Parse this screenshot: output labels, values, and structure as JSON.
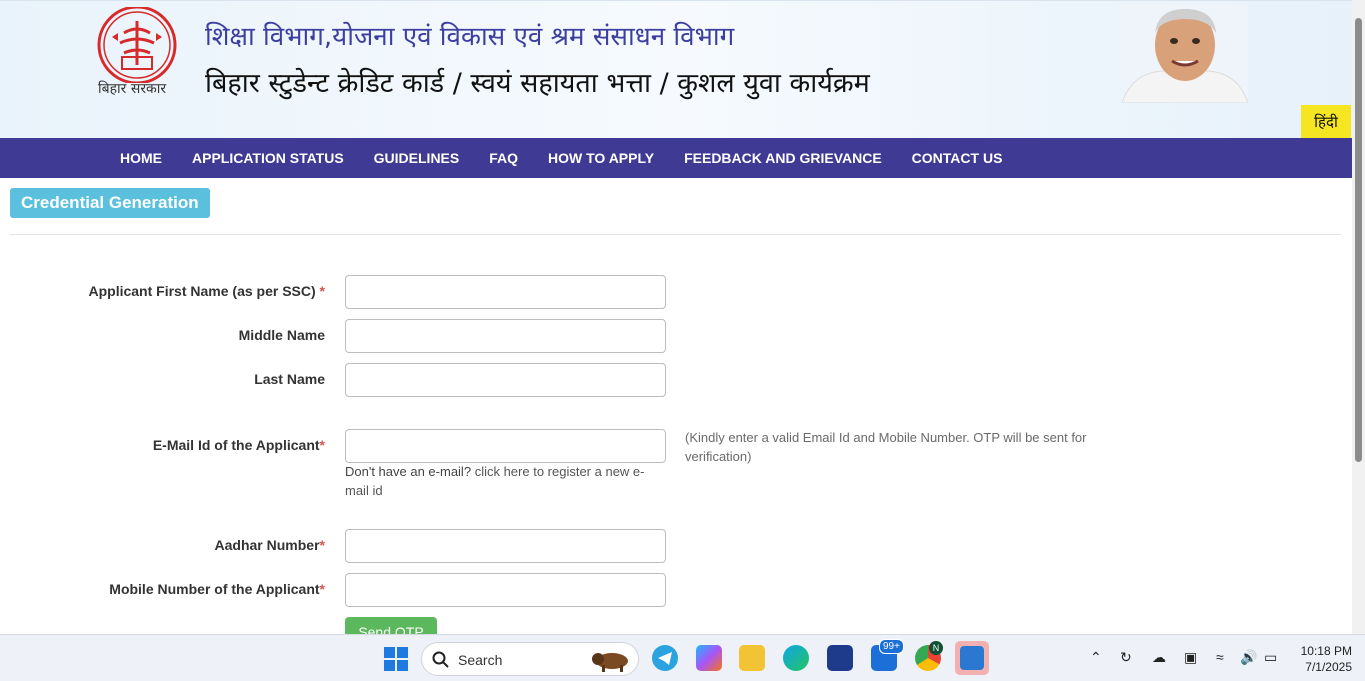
{
  "header": {
    "emblem_caption": "बिहार सरकार",
    "title_line1": "शिक्षा विभाग,योजना एवं विकास एवं श्रम संसाधन विभाग",
    "title_line2": "बिहार स्टुडेन्ट क्रेडिट कार्ड / स्वयं सहायता भत्ता / कुशल युवा कार्यक्रम",
    "language_button": "हिंदी"
  },
  "nav": {
    "items": [
      {
        "label": "HOME"
      },
      {
        "label": "APPLICATION STATUS"
      },
      {
        "label": "GUIDELINES"
      },
      {
        "label": "FAQ"
      },
      {
        "label": "HOW TO APPLY"
      },
      {
        "label": "FEEDBACK AND GRIEVANCE"
      },
      {
        "label": "CONTACT US"
      }
    ]
  },
  "section": {
    "title": "Credential Generation"
  },
  "form": {
    "first_name_label": "Applicant First Name (as per SSC)",
    "middle_name_label": "Middle Name",
    "last_name_label": "Last Name",
    "email_label": "E-Mail Id of the Applicant",
    "email_help_prefix": "Don't have an e-mail?",
    "email_help_link": "click here to register a new e-mail id",
    "email_note": "(Kindly enter a valid Email Id and Mobile Number. OTP will be sent for verification)",
    "aadhar_label": "Aadhar Number",
    "mobile_label": "Mobile Number of the Applicant",
    "required_mark": "*",
    "send_otp_label": "Send OTP"
  },
  "taskbar": {
    "search_label": "Search",
    "badge_count": "99+",
    "profile_letter": "N",
    "time": "10:18 PM",
    "date": "7/1/2025"
  },
  "colors": {
    "nav_bg": "#3f3a94",
    "section_title_bg": "#5bc0de",
    "otp_button_bg": "#5cb85c",
    "lang_button_bg": "#f5e621",
    "title1_color": "#3c3fa0",
    "required_color": "#d9534f"
  }
}
